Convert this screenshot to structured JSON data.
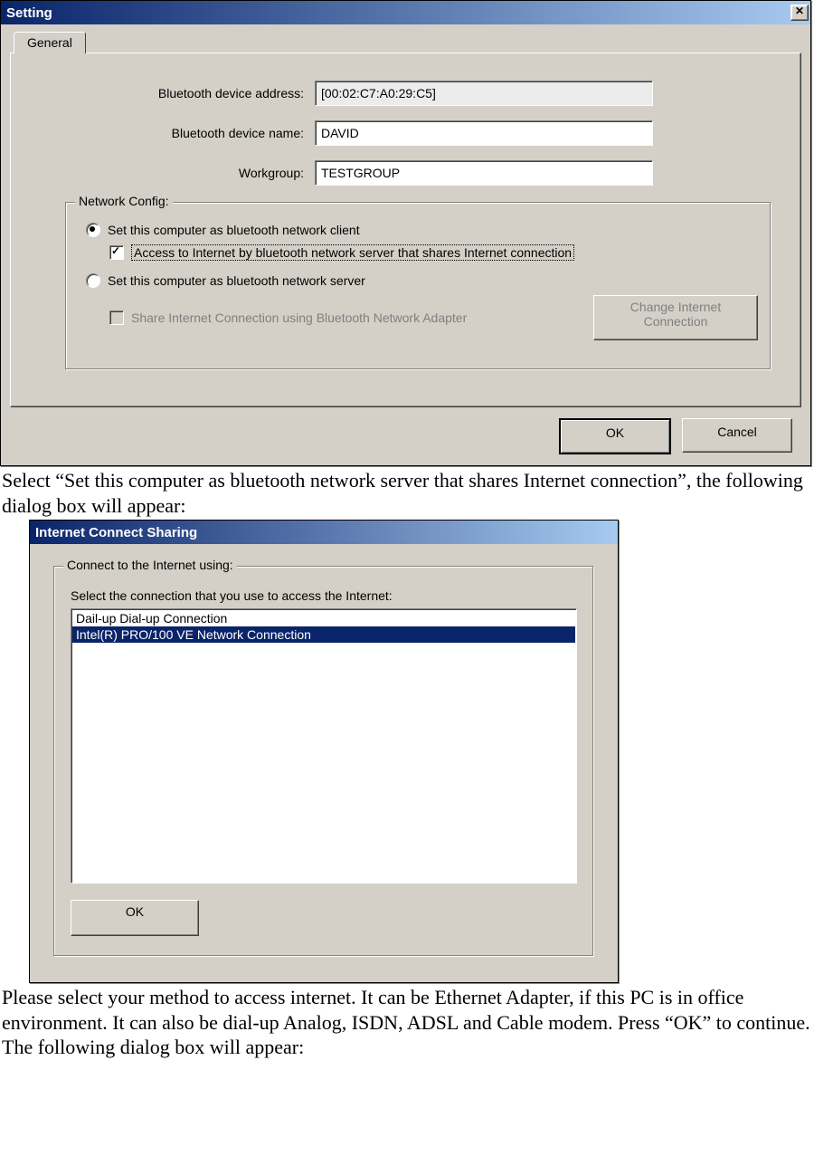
{
  "dialog1": {
    "title": "Setting",
    "close_glyph": "✕",
    "tab_general": "General",
    "labels": {
      "bt_addr": "Bluetooth device address:",
      "bt_name": "Bluetooth device name:",
      "workgroup": "Workgroup:"
    },
    "values": {
      "bt_addr": "[00:02:C7:A0:29:C5]",
      "bt_name": "DAVID",
      "workgroup": "TESTGROUP"
    },
    "network": {
      "legend": "Network Config:",
      "radio_client": "Set this computer as bluetooth network client",
      "check_access": "Access to Internet by bluetooth network server that shares Internet connection",
      "radio_server": "Set this computer as bluetooth network server",
      "check_share": "Share Internet Connection using Bluetooth Network Adapter",
      "change_btn": "Change Internet Connection"
    },
    "buttons": {
      "ok": "OK",
      "cancel": "Cancel"
    }
  },
  "para1": "Select “Set this computer as bluetooth network server that shares Internet connection”, the following dialog box will appear:",
  "dialog2": {
    "title": "Internet Connect Sharing",
    "fieldset_legend": "Connect to the Internet using:",
    "instruction": "Select the connection that you use to access the Internet:",
    "items": [
      "Dail-up Dial-up Connection",
      "Intel(R) PRO/100 VE Network Connection"
    ],
    "selected_index": 1,
    "ok": "OK"
  },
  "para2": "Please select your method to access internet. It can be Ethernet Adapter, if this PC is in office environment. It can also be dial-up Analog, ISDN, ADSL and Cable modem. Press “OK” to continue. The following dialog box will appear:"
}
